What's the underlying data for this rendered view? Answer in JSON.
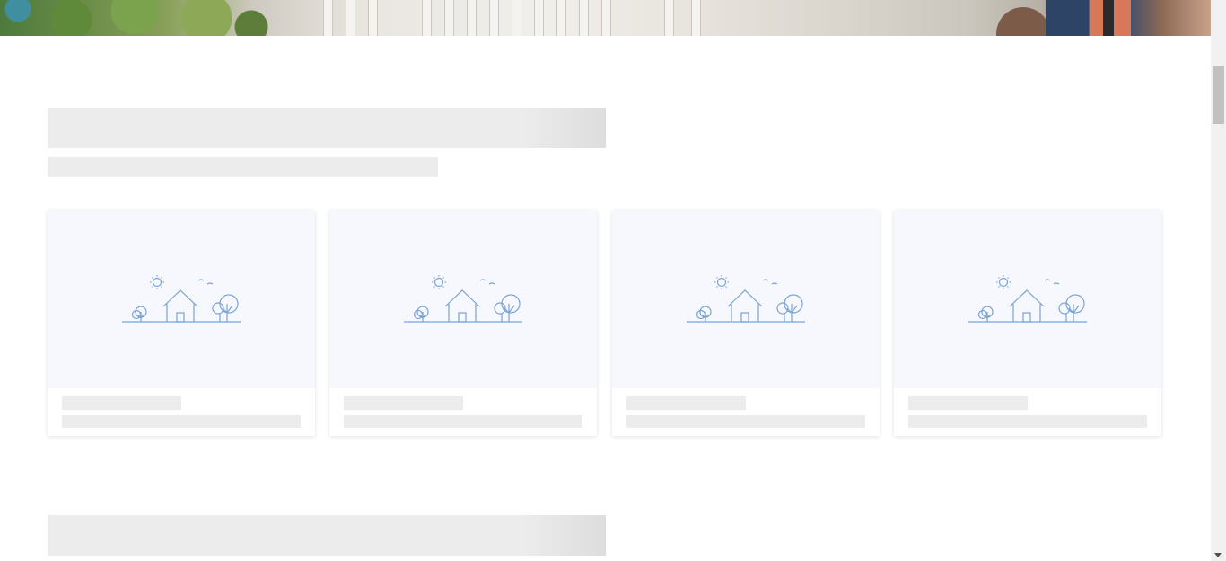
{
  "hero": {
    "image": "house-porch-photo"
  },
  "section1": {
    "cards": [
      {
        "placeholder_icon": "house-landscape-icon"
      },
      {
        "placeholder_icon": "house-landscape-icon"
      },
      {
        "placeholder_icon": "house-landscape-icon"
      },
      {
        "placeholder_icon": "house-landscape-icon"
      }
    ]
  },
  "colors": {
    "skeleton": "#ececec",
    "card_media_bg": "#f6f8fd",
    "icon_stroke": "#7aa3d4"
  }
}
